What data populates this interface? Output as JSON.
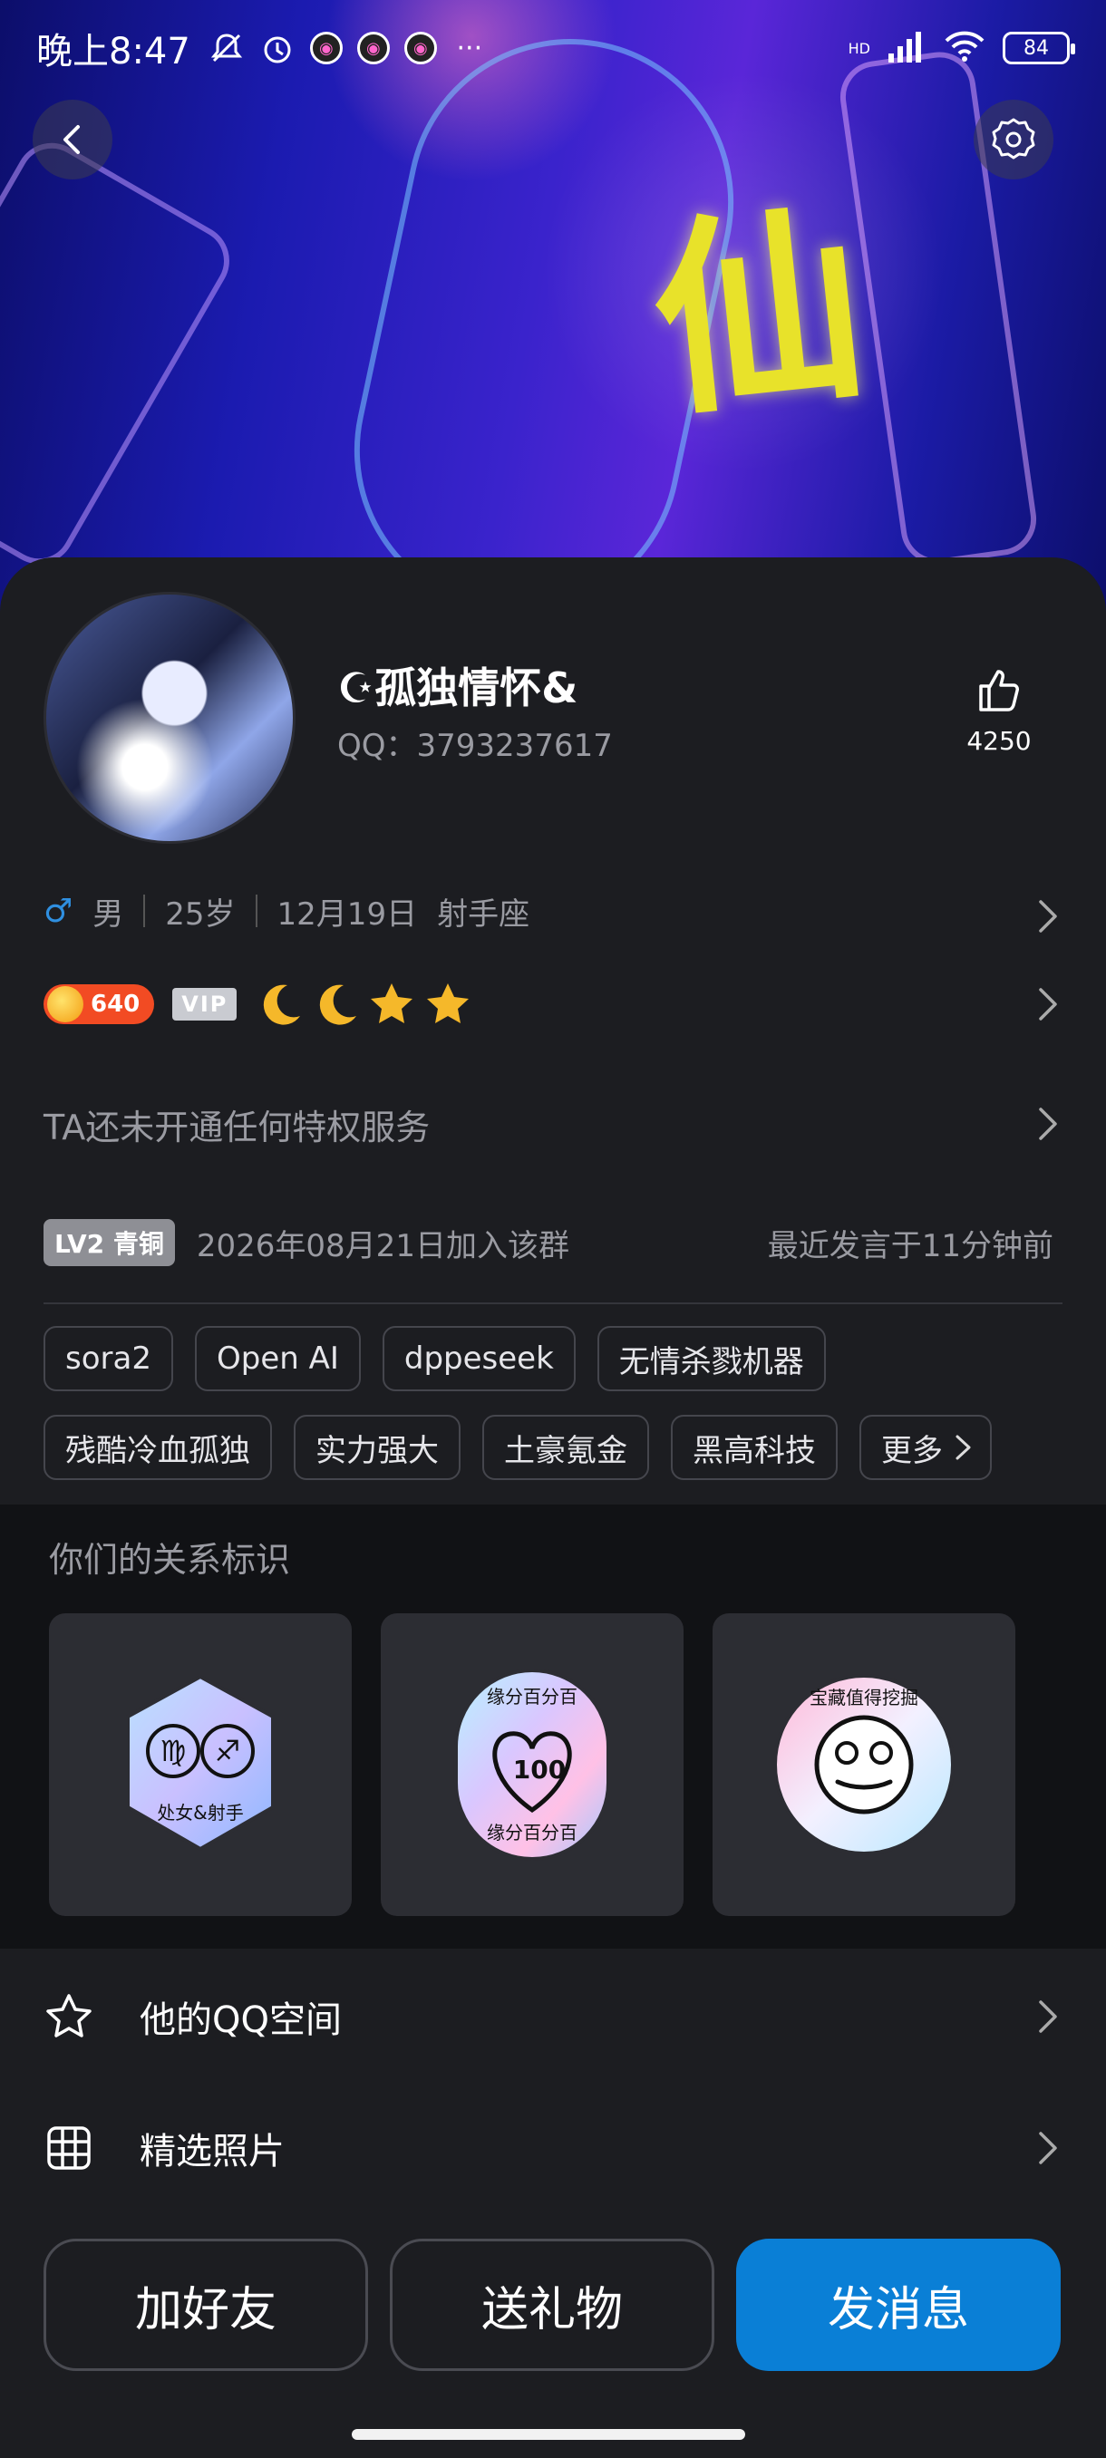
{
  "status_bar": {
    "time": "晚上8:47",
    "icons": [
      "mute-icon",
      "alarm-icon",
      "app-icon-1",
      "app-icon-2",
      "app-icon-3",
      "more-icon"
    ],
    "more": "···",
    "network": "HD",
    "battery": "84"
  },
  "hero": {
    "glyph": "仙"
  },
  "profile": {
    "nickname": "☪孤独情怀&",
    "qq": "QQ：3793237617",
    "likes": "4250",
    "gender_symbol": "♂",
    "gender": "男",
    "age": "25岁",
    "birthday": "12月19日",
    "zodiac": "射手座",
    "coins": "640",
    "vip_label": "VIP",
    "privilege_text": "TA还未开通任何特权服务"
  },
  "group": {
    "level_badge": "LV2 青铜",
    "joined": "2026年08月21日加入该群",
    "last_speak": "最近发言于11分钟前"
  },
  "tags": {
    "row1": [
      "sora2",
      "Open AI",
      "dppeseek",
      "无情杀戮机器"
    ],
    "row2": [
      "残酷冷血孤独",
      "实力强大",
      "土豪氪金",
      "黑高科技"
    ],
    "more": "更多"
  },
  "relationship": {
    "title": "你们的关系标识",
    "cards": [
      {
        "caption": "处女&射手",
        "icon": "zodiac-badge-icon"
      },
      {
        "top_text": "缘分百分百",
        "bottom_text": "缘分百分百",
        "number": "100",
        "icon": "heart-badge-icon"
      },
      {
        "ring_text": "宝藏值得挖掘",
        "icon": "treasure-badge-icon"
      }
    ]
  },
  "menu": {
    "qzone": "他的QQ空间",
    "photos": "精选照片"
  },
  "actions": {
    "add_friend": "加好友",
    "gift": "送礼物",
    "message": "发消息"
  },
  "colors": {
    "accent": "#0a7fd6",
    "background": "#1c1d21",
    "coin": "#f24b23"
  }
}
